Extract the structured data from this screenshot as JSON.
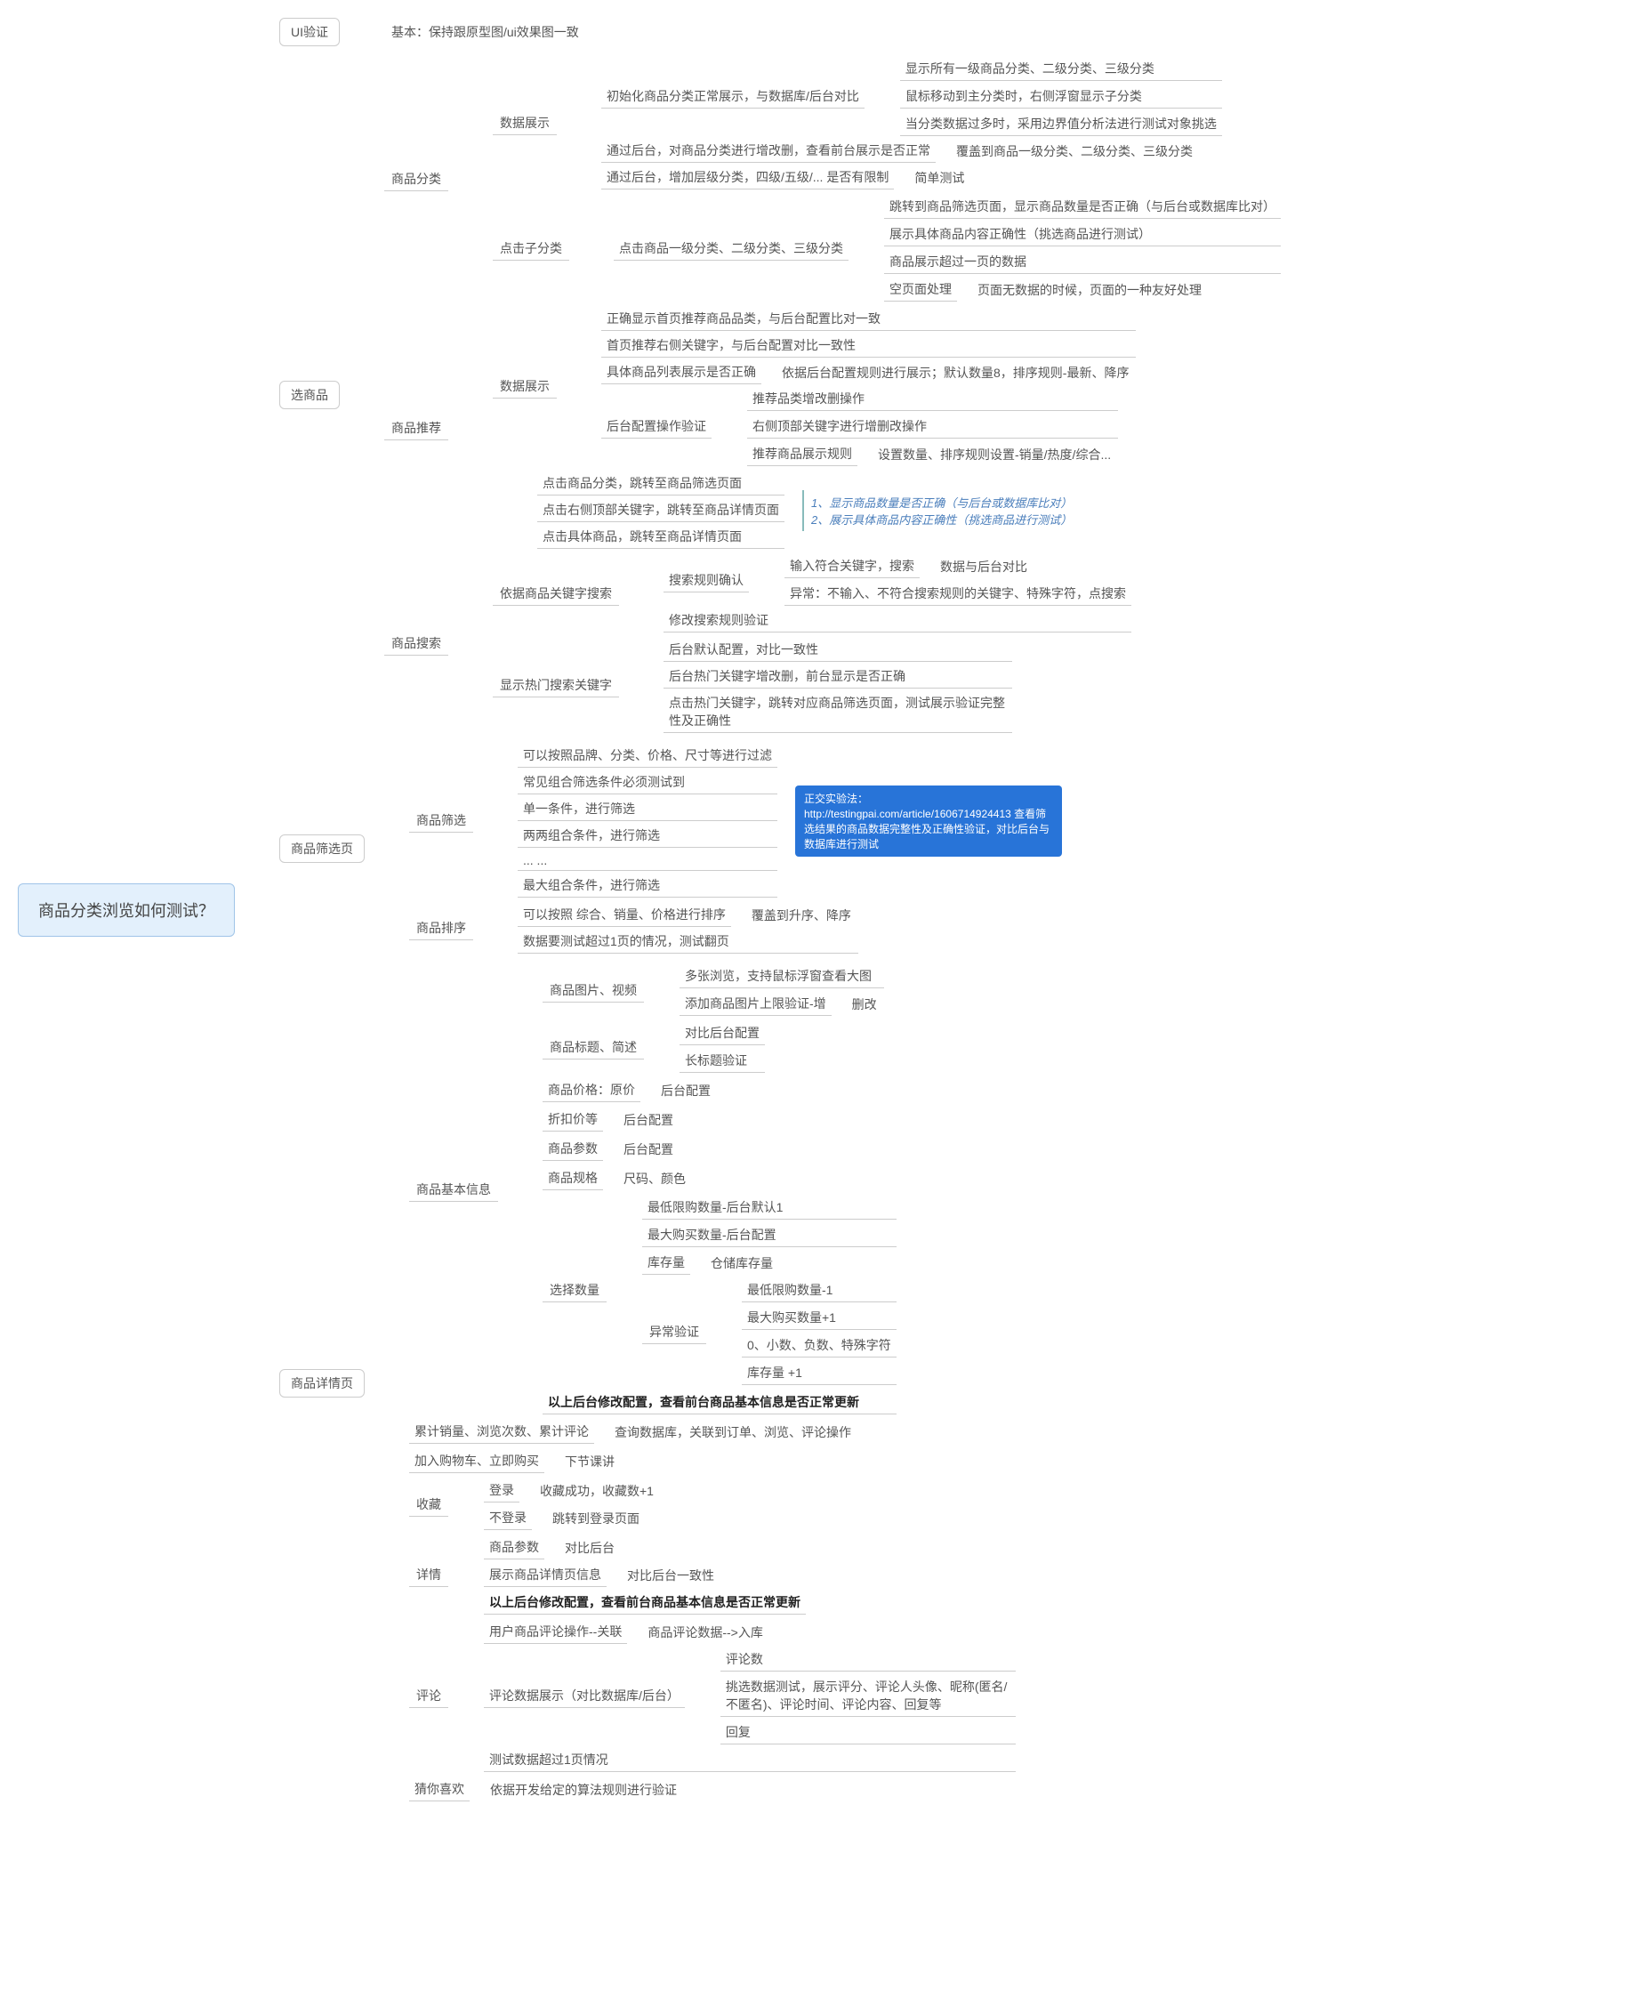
{
  "root": "商品分类浏览如何测试？",
  "b1": {
    "t": "UI验证",
    "desc": "基本：保持跟原型图/ui效果图一致"
  },
  "b2": {
    "t": "选商品",
    "s1": {
      "t": "商品分类",
      "d": {
        "t": "数据展示",
        "i1": {
          "t": "初始化商品分类正常展示，与数据库/后台对比",
          "c1": "显示所有一级商品分类、二级分类、三级分类",
          "c2": "鼠标移动到主分类时，右侧浮窗显示子分类",
          "c3": "当分类数据过多时，采用边界值分析法进行测试对象挑选"
        },
        "i2": {
          "t": "通过后台，对商品分类进行增改删，查看前台展示是否正常",
          "note": "覆盖到商品一级分类、二级分类、三级分类"
        },
        "i3": {
          "t": "通过后台，增加层级分类，四级/五级/... 是否有限制",
          "note": "简单测试"
        }
      },
      "c": {
        "t": "点击子分类",
        "p": "点击商品一级分类、二级分类、三级分类",
        "c1": "跳转到商品筛选页面，显示商品数量是否正确（与后台或数据库比对）",
        "c2": "展示具体商品内容正确性（挑选商品进行测试）",
        "c3": "商品展示超过一页的数据",
        "c4": {
          "a": "空页面处理",
          "b": "页面无数据的时候，页面的一种友好处理"
        }
      }
    },
    "s2": {
      "t": "商品推荐",
      "d": {
        "t": "数据展示",
        "i1": "正确显示首页推荐商品品类，与后台配置比对一致",
        "i2": "首页推荐右侧关键字，与后台配置对比一致性",
        "i3": {
          "a": "具体商品列表展示是否正确",
          "b": "依据后台配置规则进行展示；默认数量8，排序规则-最新、降序"
        },
        "cfg": {
          "t": "后台配置操作验证",
          "c1": "推荐品类增改删操作",
          "c2": "右侧顶部关键字进行增删改操作",
          "c3": {
            "a": "推荐商品展示规则",
            "b": "设置数量、排序规则设置-销量/热度/综合..."
          }
        }
      },
      "j": {
        "j1": "点击商品分类，跳转至商品筛选页面",
        "j2": "点击右侧顶部关键字，跳转至商品详情页面",
        "j3": "点击具体商品，跳转至商品详情页面",
        "note": "1、显示商品数量是否正确（与后台或数据库比对）\n2、展示具体商品内容正确性（挑选商品进行测试）"
      }
    },
    "s3": {
      "t": "商品搜索",
      "k": {
        "t": "依据商品关键字搜索",
        "r": {
          "t": "搜索规则确认",
          "c1": {
            "a": "输入符合关键字，搜索",
            "b": "数据与后台对比"
          },
          "c2": "异常：不输入、不符合搜索规则的关键字、特殊字符，点搜索"
        },
        "m": "修改搜索规则验证"
      },
      "h": {
        "t": "显示热门搜索关键字",
        "c1": "后台默认配置，对比一致性",
        "c2": "后台热门关键字增改删，前台显示是否正确",
        "c3": "点击热门关键字，跳转对应商品筛选页面，测试展示验证完整性及正确性"
      }
    }
  },
  "b3": {
    "t": "商品筛选页",
    "f": {
      "t": "商品筛选",
      "c1": "可以按照品牌、分类、价格、尺寸等进行过滤",
      "c2": "常见组合筛选条件必须测试到",
      "c3": "单一条件，进行筛选",
      "c4": "两两组合条件，进行筛选",
      "c5": "... ...",
      "c6": "最大组合条件，进行筛选",
      "note": "正交实验法：http://testingpai.com/article/1606714924413\n查看筛选结果的商品数据完整性及正确性验证，对比后台与数据库进行测试"
    },
    "s": {
      "t": "商品排序",
      "c1": {
        "a": "可以按照 综合、销量、价格进行排序",
        "b": "覆盖到升序、降序"
      },
      "c2": "数据要测试超过1页的情况，测试翻页"
    }
  },
  "b4": {
    "t": "商品详情页",
    "base": {
      "t": "商品基本信息",
      "img": {
        "t": "商品图片、视频",
        "c1": "多张浏览，支持鼠标浮窗查看大图",
        "c2": {
          "a": "添加商品图片上限验证-增",
          "b": "删改"
        }
      },
      "tit": {
        "t": "商品标题、简述",
        "c1": "对比后台配置",
        "c2": "长标题验证"
      },
      "price": {
        "a": "商品价格：原价",
        "b": "后台配置"
      },
      "disc": {
        "a": "折扣价等",
        "b": "后台配置"
      },
      "param": {
        "a": "商品参数",
        "b": "后台配置"
      },
      "spec": {
        "a": "商品规格",
        "b": "尺码、颜色"
      },
      "qty": {
        "t": "选择数量",
        "c1": "最低限购数量-后台默认1",
        "c2": "最大购买数量-后台配置",
        "c3": {
          "a": "库存量",
          "b": "仓储库存量"
        },
        "ex": {
          "t": "异常验证",
          "c1": "最低限购数量-1",
          "c2": "最大购买数量+1",
          "c3": "0、小数、负数、特殊字符",
          "c4": "库存量 +1"
        }
      },
      "upd": "以上后台修改配置，查看前台商品基本信息是否正常更新"
    },
    "stat": {
      "a": "累计销量、浏览次数、累计评论",
      "b": "查询数据库，关联到订单、浏览、评论操作"
    },
    "buy": {
      "a": "加入购物车、立即购买",
      "b": "下节课讲"
    },
    "fav": {
      "t": "收藏",
      "c1": {
        "a": "登录",
        "b": "收藏成功，收藏数+1"
      },
      "c2": {
        "a": "不登录",
        "b": "跳转到登录页面"
      }
    },
    "det": {
      "t": "详情",
      "c1": {
        "a": "商品参数",
        "b": "对比后台"
      },
      "c2": {
        "a": "展示商品详情页信息",
        "b": "对比后台一致性"
      },
      "c3": "以上后台修改配置，查看前台商品基本信息是否正常更新"
    },
    "rev": {
      "t": "评论",
      "c1": {
        "a": "用户商品评论操作--关联",
        "b": "商品评论数据-->入库"
      },
      "show": {
        "t": "评论数据展示（对比数据库/后台）",
        "c1": "评论数",
        "c2": "挑选数据测试，展示评分、评论人头像、昵称(匿名/不匿名)、评论时间、评论内容、回复等",
        "c3": "回复"
      },
      "pg": "测试数据超过1页情况"
    },
    "like": {
      "a": "猜你喜欢",
      "b": "依据开发给定的算法规则进行验证"
    }
  }
}
